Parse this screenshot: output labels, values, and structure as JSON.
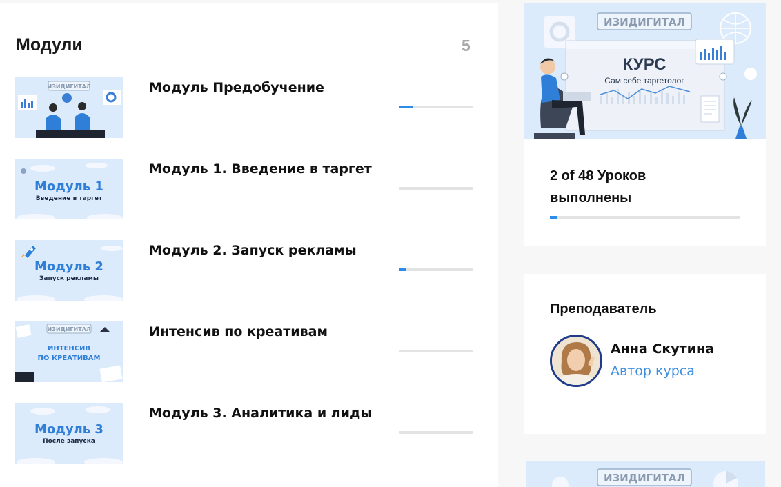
{
  "modules": {
    "title": "Модули",
    "count": "5",
    "items": [
      {
        "title": "Модуль Предобучение",
        "progress": 0.2,
        "thumb_brand": "ИЗИДИГИТАЛ",
        "thumb_line1": "",
        "thumb_line2": ""
      },
      {
        "title": "Модуль 1. Введение в таргет",
        "progress": 0.0,
        "thumb_brand": "",
        "thumb_line1": "Модуль 1",
        "thumb_line2": "Введение в таргет"
      },
      {
        "title": "Модуль 2. Запуск рекламы",
        "progress": 0.09,
        "thumb_brand": "",
        "thumb_line1": "Модуль 2",
        "thumb_line2": "Запуск рекламы"
      },
      {
        "title": "Интенсив по креативам",
        "progress": 0.0,
        "thumb_brand": "ИЗИДИГИТАЛ",
        "thumb_line1": "ИНТЕНСИВ",
        "thumb_line2": "ПО КРЕАТИВАМ"
      },
      {
        "title": "Модуль 3. Аналитика и лиды",
        "progress": 0.0,
        "thumb_brand": "",
        "thumb_line1": "Модуль 3",
        "thumb_line2": "После запуска"
      }
    ]
  },
  "course": {
    "brand": "ИЗИДИГИТАЛ",
    "cover_title": "КУРС",
    "cover_subtitle": "Сам себе таргетолог",
    "lessons_done": "2 of 48 Уроков выполнены",
    "progress": 0.04
  },
  "teacher": {
    "heading": "Преподаватель",
    "name": "Анна Скутина",
    "role": "Автор курса"
  },
  "bottom_card": {
    "brand": "ИЗИДИГИТАЛ"
  },
  "colors": {
    "accent": "#2f8bea",
    "link": "#3d8fe0",
    "thumb_bg": "#dcebfc",
    "track": "#e3e3e3"
  }
}
